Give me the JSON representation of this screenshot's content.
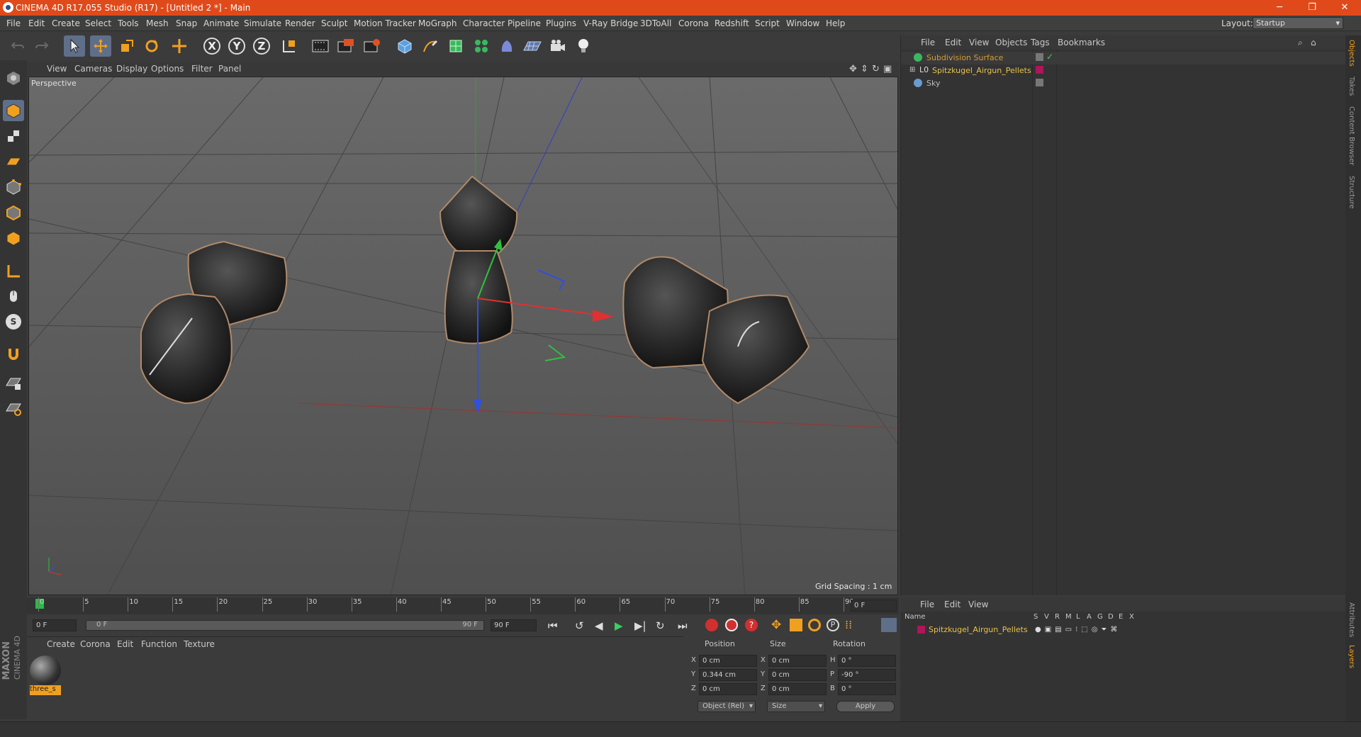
{
  "window": {
    "title": "CINEMA 4D R17.055 Studio (R17) - [Untitled 2 *] - Main",
    "controls": [
      "─",
      "❐",
      "✕"
    ]
  },
  "menu": {
    "items": [
      "File",
      "Edit",
      "Create",
      "Select",
      "Tools",
      "Mesh",
      "Snap",
      "Animate",
      "Simulate",
      "Render",
      "Sculpt",
      "Motion Tracker",
      "MoGraph",
      "Character",
      "Pipeline",
      "Plugins",
      "V-Ray Bridge",
      "3DToAll",
      "Corona",
      "Redshift",
      "Script",
      "Window",
      "Help"
    ],
    "layout_label": "Layout:",
    "layout_value": "Startup"
  },
  "toolbar": {
    "axis_x": "X",
    "axis_y": "Y",
    "axis_z": "Z"
  },
  "viewport": {
    "menu": [
      "View",
      "Cameras",
      "Display",
      "Options",
      "Filter",
      "Panel"
    ],
    "label": "Perspective",
    "grid_spacing": "Grid Spacing : 1 cm"
  },
  "timeline": {
    "ticks": [
      "0",
      "5",
      "10",
      "15",
      "20",
      "25",
      "30",
      "35",
      "40",
      "45",
      "50",
      "55",
      "60",
      "65",
      "70",
      "75",
      "80",
      "85",
      "90"
    ],
    "current_frame_field": "0 F",
    "start_field": "0 F",
    "range_start": "0 F",
    "range_end": "90 F",
    "end_field": "90 F"
  },
  "material_manager": {
    "menu": [
      "Create",
      "Corona",
      "Edit",
      "Function",
      "Texture"
    ],
    "material_name": "three_s"
  },
  "coordinates": {
    "headers": {
      "position": "Position",
      "size": "Size",
      "rotation": "Rotation"
    },
    "rows": [
      {
        "axis": "X",
        "pos": "0 cm",
        "size_axis": "X",
        "size": "0 cm",
        "rot_axis": "H",
        "rot": "0 °"
      },
      {
        "axis": "Y",
        "pos": "0.344 cm",
        "size_axis": "Y",
        "size": "0 cm",
        "rot_axis": "P",
        "rot": "-90 °"
      },
      {
        "axis": "Z",
        "pos": "0 cm",
        "size_axis": "Z",
        "size": "0 cm",
        "rot_axis": "B",
        "rot": "0 °"
      }
    ],
    "mode": "Object (Rel)",
    "size_mode": "Size",
    "apply": "Apply"
  },
  "object_manager": {
    "menu": [
      "File",
      "Edit",
      "View",
      "Objects",
      "Tags",
      "Bookmarks"
    ],
    "objects": [
      {
        "name": "Subdivision Surface",
        "color": "#d89b2e"
      },
      {
        "name": "Spitzkugel_Airgun_Pellets",
        "color": "#e8c24a"
      },
      {
        "name": "Sky",
        "color": "#bdbdbd"
      }
    ]
  },
  "layer_manager": {
    "menu": [
      "File",
      "Edit",
      "View"
    ],
    "columns": [
      "Name",
      "S",
      "V",
      "R",
      "M",
      "L",
      "A",
      "G",
      "D",
      "E",
      "X"
    ],
    "layer_name": "Spitzkugel_Airgun_Pellets",
    "layer_color": "#b0155a"
  },
  "right_tabs": [
    "Objects",
    "Takes",
    "Content Browser",
    "Structure",
    "Attributes",
    "Layers"
  ],
  "branding": {
    "maxon": "MAXON",
    "product": "CINEMA 4D"
  },
  "colors": {
    "title_bar": "#e04a1a",
    "active_tool": "#5f6f8a",
    "axis_x": "#e03030",
    "axis_y": "#30c040",
    "axis_z": "#3050e0"
  }
}
